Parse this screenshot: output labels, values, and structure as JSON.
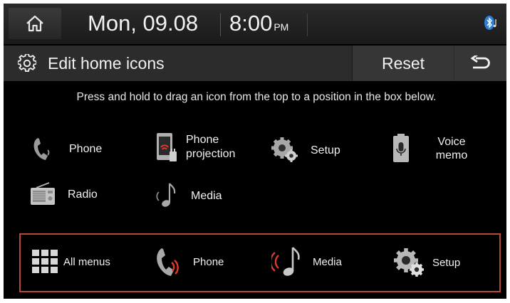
{
  "status": {
    "date": "Mon, 09.08",
    "time": "8:00",
    "ampm": "PM"
  },
  "titlebar": {
    "title": "Edit home icons",
    "reset_label": "Reset"
  },
  "instruction": "Press and hold to drag an icon from the top to a position in the box below.",
  "available_icons": [
    {
      "label": "Phone",
      "icon": "phone-icon"
    },
    {
      "label": "Phone projection",
      "icon": "phone-projection-icon"
    },
    {
      "label": "Setup",
      "icon": "setup-gear-icon"
    },
    {
      "label": "Voice memo",
      "icon": "voice-memo-icon"
    },
    {
      "label": "Radio",
      "icon": "radio-icon"
    },
    {
      "label": "Media",
      "icon": "music-note-icon"
    }
  ],
  "dock_icons": [
    {
      "label": "All menus",
      "icon": "all-menus-grid-icon"
    },
    {
      "label": "Phone",
      "icon": "phone-icon"
    },
    {
      "label": "Media",
      "icon": "music-note-icon"
    },
    {
      "label": "Setup",
      "icon": "setup-gear-icon"
    }
  ],
  "colors": {
    "background": "#000000",
    "dock_border": "#b8483a",
    "accent_red": "#e03a2e"
  }
}
